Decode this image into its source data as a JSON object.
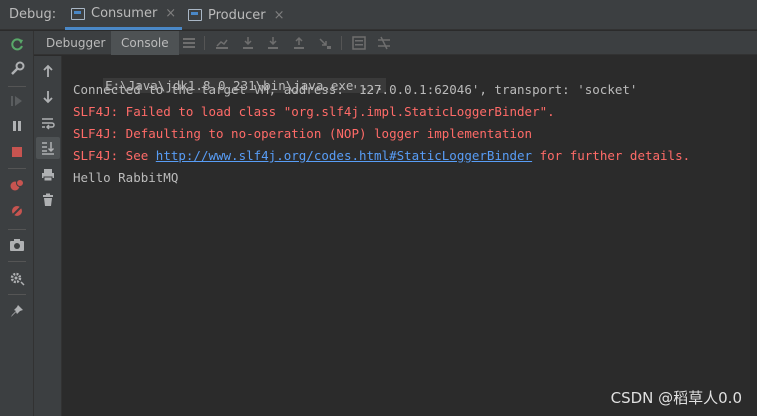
{
  "header": {
    "debug_label": "Debug:",
    "tabs": [
      {
        "label": "Consumer",
        "icon": "run-config-icon"
      },
      {
        "label": "Producer",
        "icon": "run-config-icon"
      }
    ],
    "close_glyph": "×"
  },
  "subtabs": [
    {
      "label": "Debugger"
    },
    {
      "label": "Console"
    }
  ],
  "console": {
    "command": "E:\\Java\\jdk1.8.0_231\\bin\\java.exe ...",
    "connected": "Connected to the target VM, address: '127.0.0.1:62046', transport: 'socket'",
    "err1": "SLF4J: Failed to load class \"org.slf4j.impl.StaticLoggerBinder\".",
    "err2": "SLF4J: Defaulting to no-operation (NOP) logger implementation",
    "err3_prefix": "SLF4J: See ",
    "err3_link": "http://www.slf4j.org/codes.html#StaticLoggerBinder",
    "err3_suffix": " for further details.",
    "output": "Hello RabbitMQ"
  },
  "watermark": "CSDN @稻草人0.0",
  "colors": {
    "background": "#2b2b2b",
    "toolbar": "#3c3f41",
    "error": "#ff6b68",
    "link": "#589df6",
    "accent": "#4a88c7"
  }
}
